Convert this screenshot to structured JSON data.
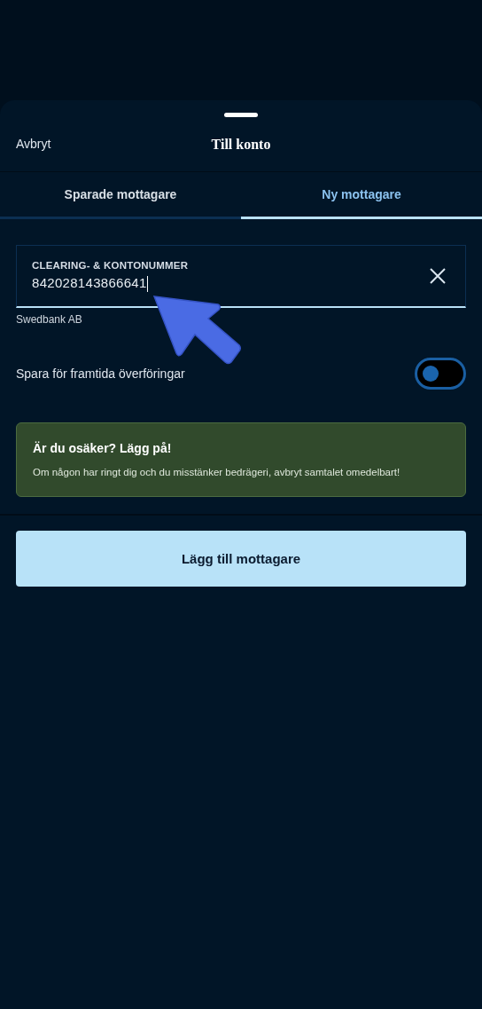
{
  "header": {
    "cancel": "Avbryt",
    "title": "Till konto"
  },
  "tabs": [
    {
      "label": "Sparade mottagare",
      "selected": false
    },
    {
      "label": "Ny mottagare",
      "selected": true
    }
  ],
  "account_field": {
    "label": "CLEARING- & KONTONUMMER",
    "value": "842028143866641",
    "bank": "Swedbank AB"
  },
  "save_toggle": {
    "label": "Spara för framtida överföringar",
    "on": false
  },
  "alert": {
    "title": "Är du osäker? Lägg på!",
    "text": "Om någon har ringt dig och du misstänker bedrägeri, avbryt samtalet omedelbart!"
  },
  "primary_button": "Lägg till mottagare"
}
